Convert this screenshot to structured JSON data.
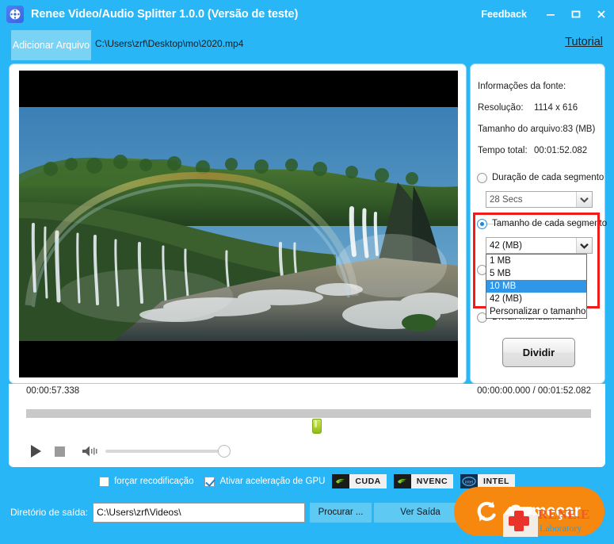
{
  "titlebar": {
    "app_icon": "film-reel-icon",
    "title": "Renee Video/Audio Splitter 1.0.0 (Versão de teste)",
    "feedback_label": "Feedback",
    "minimize_icon": "minimize-icon",
    "maximize_icon": "maximize-icon",
    "close_icon": "close-icon",
    "background_color": "#29b6f6"
  },
  "toolbar": {
    "add_file_label": "Adicionar Arquivo",
    "file_path": "C:\\Users\\zrf\\Desktop\\mo\\2020.mp4",
    "tutorial_label": "Tutorial"
  },
  "preview": {
    "description": "Iguazu Falls with rainbow, letterboxed video frame"
  },
  "timeline": {
    "current_position_label": "00:00:57.338",
    "position_of_total": "00:00:00.000 / 00:01:52.082",
    "marker_color": "#b6d436",
    "play_icon": "play-icon",
    "stop_icon": "stop-icon",
    "volume_icon": "volume-icon"
  },
  "source_info": {
    "heading": "Informações da fonte:",
    "resolution_label": "Resolução:",
    "resolution_value": "1114 x 616",
    "filesize_label": "Tamanho do arquivo:83 (MB)",
    "duration_label": "Tempo total:",
    "duration_value": "00:01:52.082"
  },
  "split_options": {
    "duration_option": {
      "label": "Duração de cada segmento",
      "selected": false,
      "combo_value": "28 Secs"
    },
    "size_option": {
      "label": "Tamanho de cada segmento",
      "selected": true,
      "combo_value": "42 (MB)",
      "dropdown_open": true,
      "dropdown_items": [
        "1 MB",
        "5 MB",
        "10 MB",
        "42 (MB)",
        "Personalizar o tamanho"
      ],
      "dropdown_highlighted": "10 MB",
      "highlight_color": "#2f96e8"
    },
    "manual_option": {
      "label": "Dividir manualmente",
      "selected": false
    },
    "split_button_label": "Dividir",
    "highlight_box_color": "#ef1c1c"
  },
  "bottom_options": {
    "force_recode": {
      "label": "forçar recodificação",
      "checked": false
    },
    "gpu_accel": {
      "label": "Ativar aceleração de GPU",
      "checked": true
    },
    "badges": [
      {
        "name": "CUDA",
        "icon": "nvidia-icon"
      },
      {
        "name": "NVENC",
        "icon": "nvidia-icon"
      },
      {
        "name": "INTEL",
        "icon": "intel-icon"
      }
    ]
  },
  "output": {
    "label": "Diretório de saída:",
    "path_value": "C:\\Users\\zrf\\Videos\\",
    "browse_label": "Procurar ...",
    "view_label": "Ver Saída"
  },
  "start_button": {
    "label": "Começar",
    "icon": "refresh-circular-icon",
    "color": "#f7880f"
  },
  "watermark": {
    "brand": "RENE.E",
    "sub": "Laboratory",
    "icon": "medical-cross-icon"
  }
}
